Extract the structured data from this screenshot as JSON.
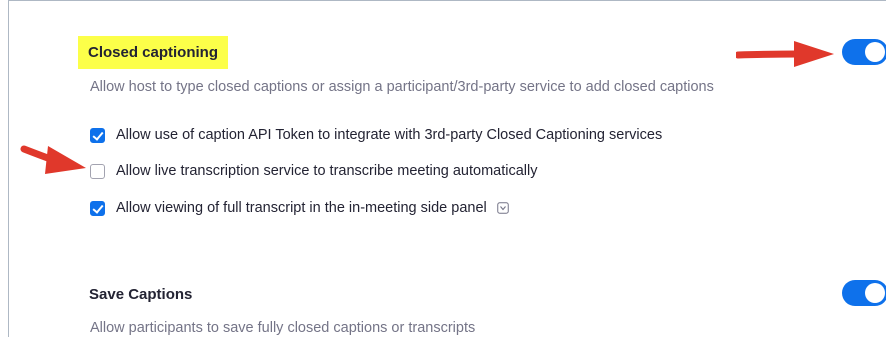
{
  "closed_captioning": {
    "title": "Closed captioning",
    "description": "Allow host to type closed captions or assign a participant/3rd-party service to add closed captions",
    "enabled": true,
    "options": [
      {
        "label": "Allow use of caption API Token to integrate with 3rd-party Closed Captioning services",
        "checked": true
      },
      {
        "label": "Allow live transcription service to transcribe meeting automatically",
        "checked": false
      },
      {
        "label": "Allow viewing of full transcript in the in-meeting side panel",
        "checked": true
      }
    ]
  },
  "save_captions": {
    "title": "Save Captions",
    "description": "Allow participants to save fully closed captions or transcripts",
    "enabled": true
  },
  "icons": {
    "info": "info-icon",
    "annotation_arrow": "red-arrow-icon"
  },
  "colors": {
    "accent": "#0e71eb",
    "highlight": "#fcff49",
    "annotation": "#e0382b"
  }
}
